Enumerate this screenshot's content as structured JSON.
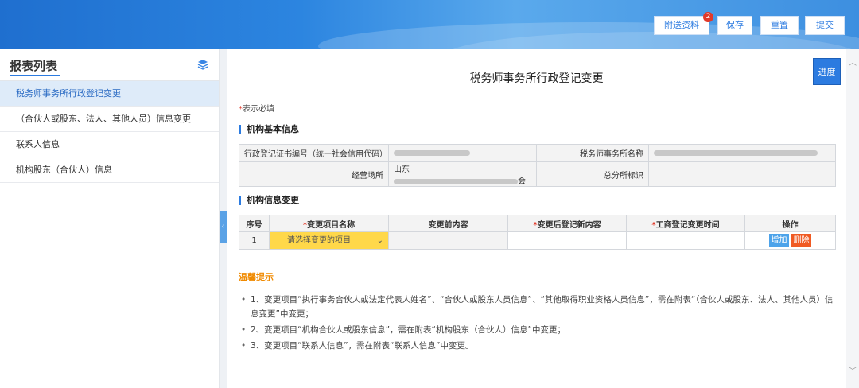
{
  "header": {
    "buttons": {
      "attach": "附送资料",
      "save": "保存",
      "reset": "重置",
      "submit": "提交"
    },
    "badge_count": "2"
  },
  "sidebar": {
    "title": "报表列表",
    "items": [
      {
        "label": "税务师事务所行政登记变更",
        "active": true
      },
      {
        "label": "（合伙人或股东、法人、其他人员）信息变更",
        "active": false
      },
      {
        "label": "联系人信息",
        "active": false
      },
      {
        "label": "机构股东（合伙人）信息",
        "active": false
      }
    ]
  },
  "main": {
    "title": "税务师事务所行政登记变更",
    "progress_button": "进度",
    "required_star": "*",
    "required_text": "表示必填",
    "basic_section": "机构基本信息",
    "basic": {
      "label_cert": "行政登记证书编号（统一社会信用代码）",
      "label_name": "税务师事务所名称",
      "label_place": "经营场所",
      "place_prefix": "山东",
      "place_suffix": "会",
      "label_branch": "总分所标识"
    },
    "change_section": "机构信息变更",
    "change_table": {
      "headers": {
        "no": "序号",
        "item": "变更项目名称",
        "before": "变更前内容",
        "after": "变更后登记新内容",
        "time": "工商登记变更时间",
        "ops": "操作"
      },
      "row": {
        "no": "1",
        "select_placeholder": "请选择变更的项目",
        "add": "增加",
        "delete": "删除"
      }
    },
    "tips_title": "温馨提示",
    "tips": [
      "1、变更项目“执行事务合伙人或法定代表人姓名”、“合伙人或股东人员信息”、“其他取得职业资格人员信息”，需在附表“（合伙人或股东、法人、其他人员）信息变更”中变更；",
      "2、变更项目“机构合伙人或股东信息”，需在附表“机构股东（合伙人）信息”中变更；",
      "3、变更项目“联系人信息”，需在附表“联系人信息”中变更。"
    ]
  },
  "colors": {
    "accent": "#2c7be0",
    "warning": "#f08a00",
    "select_bg": "#ffd84a",
    "delete": "#f05a23"
  }
}
